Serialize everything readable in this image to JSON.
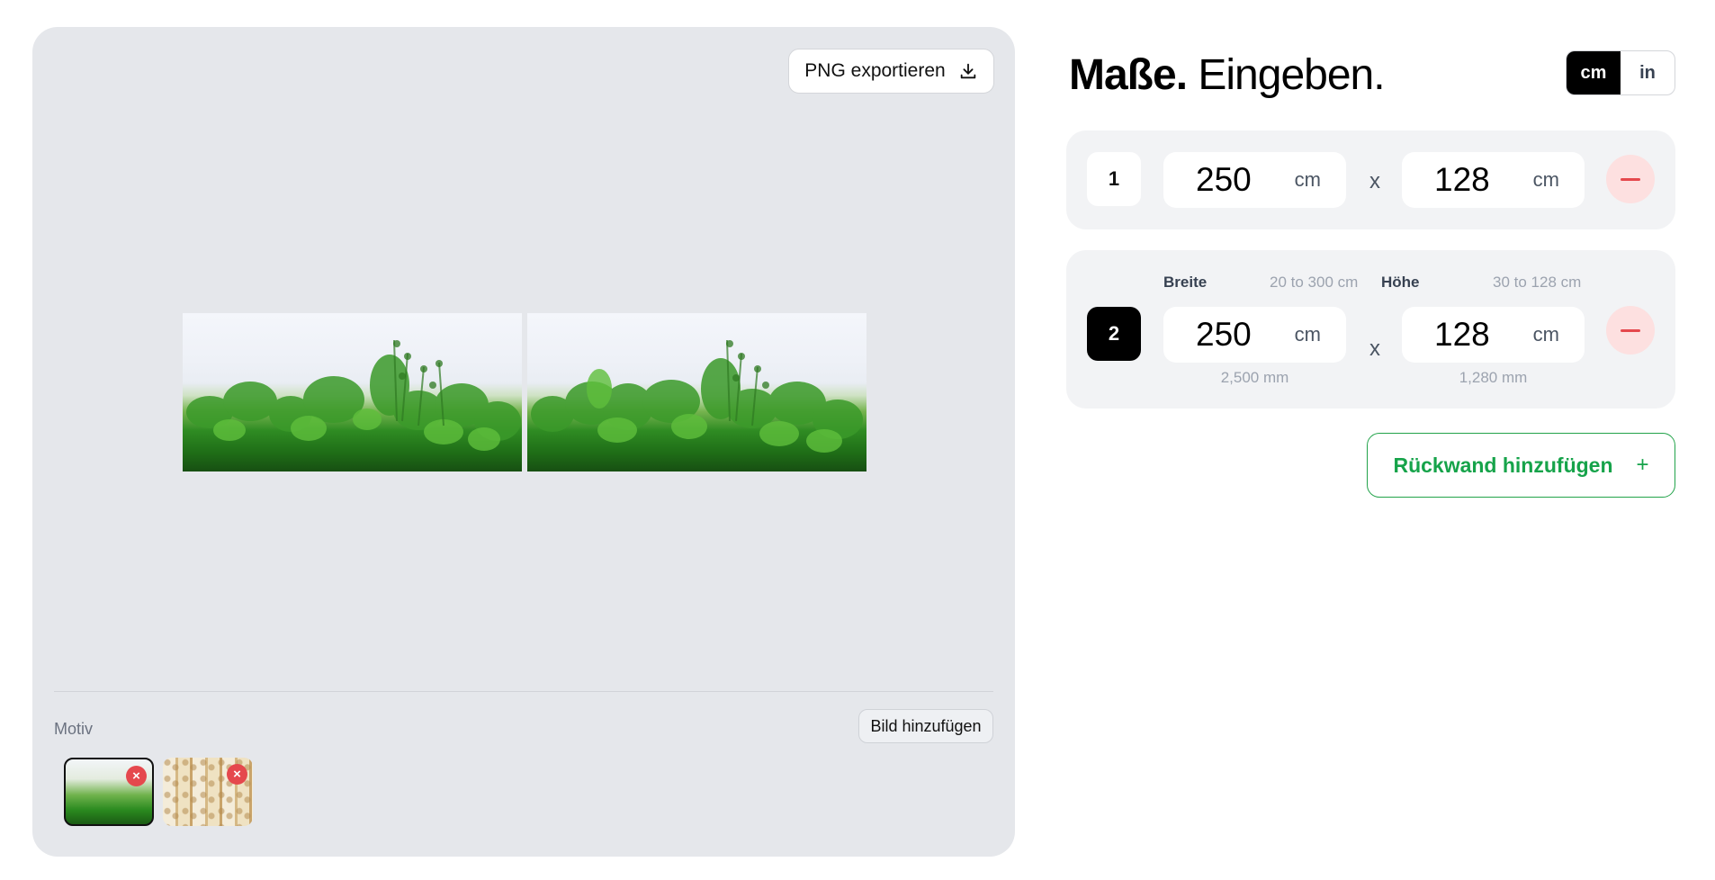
{
  "preview": {
    "export_label": "PNG exportieren",
    "export_icon": "download-icon",
    "motiv_label": "Motiv",
    "add_image_label": "Bild hinzufügen",
    "remove_icon": "close-icon",
    "remove_symbol": "×",
    "wall_count": 2,
    "thumbnails": [
      {
        "name": "herbs-thumbnail",
        "selected": true
      },
      {
        "name": "ornament-thumbnail",
        "selected": false
      }
    ]
  },
  "config": {
    "heading_bold": "Maße.",
    "heading_light": "Eingeben.",
    "units": {
      "active": "cm",
      "inactive": "in"
    },
    "times_symbol": "x",
    "rows": [
      {
        "number": "1",
        "width": "250",
        "height": "128",
        "unit": "cm",
        "selected": false
      },
      {
        "number": "2",
        "width": "250",
        "height": "128",
        "unit": "cm",
        "selected": true,
        "width_label": "Breite",
        "width_range": "20 to 300 cm",
        "width_mm": "2,500 mm",
        "height_label": "Höhe",
        "height_range": "30 to 128 cm",
        "height_mm": "1,280 mm"
      }
    ],
    "add_wall_label": "Rückwand hinzufügen",
    "add_wall_symbol": "+"
  },
  "colors": {
    "panel_bg": "#e5e7eb",
    "accent_green": "#16a34a",
    "danger_red": "#e5484d",
    "danger_bg": "#fde0e0",
    "selected_black": "#000000"
  }
}
